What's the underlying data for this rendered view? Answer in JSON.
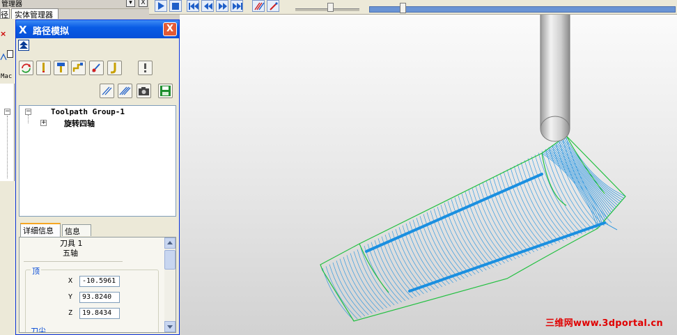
{
  "manager": {
    "title": "管理器",
    "tab_left": "径",
    "tab_entity": "实体管理器",
    "close_label": "X",
    "side_label": "Mac"
  },
  "dialog": {
    "title": "路径模拟",
    "close_label": "X",
    "tree": {
      "group": "Toolpath Group-1",
      "operation": "旋转四轴",
      "group_toggle": "−",
      "operation_toggle": "+"
    },
    "tabs": {
      "details": "详细信息",
      "info": "信息"
    },
    "details": {
      "tool": "刀具 1",
      "axis_mode": "五轴",
      "group_label": "顶",
      "x_label": "X",
      "y_label": "Y",
      "z_label": "Z",
      "x_value": "-10.5961",
      "y_value": "93.8240",
      "z_value": "19.8434",
      "next_label": "刀尖"
    }
  },
  "toolbar": {
    "icons": [
      "play-icon",
      "stop-icon",
      "rewind-icon",
      "step-back-icon",
      "step-forward-icon",
      "fast-forward-icon",
      "toolpath-display-icon",
      "tool-display-icon"
    ]
  },
  "watermark": "三维网www.3dportal.cn",
  "colors": {
    "toolpath_blue": "#1a8fe0",
    "toolpath_green": "#22c040",
    "title_blue": "#0a5ce5"
  }
}
